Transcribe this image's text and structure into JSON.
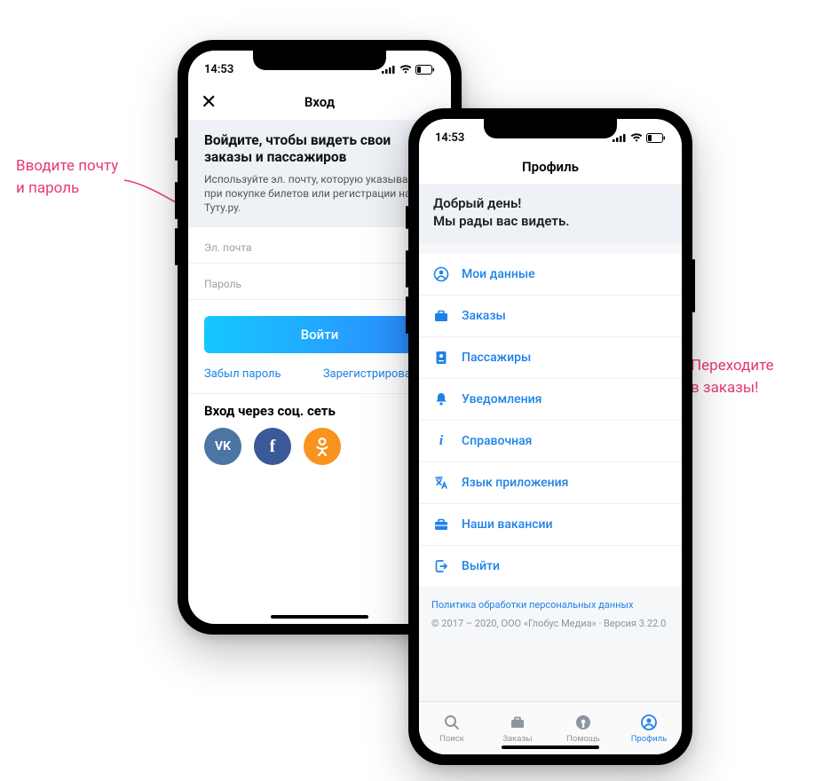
{
  "annotations": {
    "left_line1": "Вводите почту",
    "left_line2": "и пароль",
    "right_line1": "Переходите",
    "right_line2": "в заказы!"
  },
  "status": {
    "time": "14:53"
  },
  "screen1": {
    "nav_title": "Вход",
    "header_title": "Войдите, чтобы видеть свои заказы и пассажиров",
    "header_desc": "Используйте эл. почту, которую указывали при покупке билетов или регистрации на Туту.ру.",
    "email_label": "Эл. почта",
    "password_label": "Пароль",
    "login_btn": "Войти",
    "forgot": "Забыл пароль",
    "register": "Зарегистрироваться",
    "social_title": "Вход через соц. сеть",
    "vk_label": "VK",
    "fb_label": "f"
  },
  "screen2": {
    "nav_title": "Профиль",
    "greeting_line1": "Добрый день!",
    "greeting_line2": "Мы рады вас видеть.",
    "menu": {
      "my_data": "Мои данные",
      "orders": "Заказы",
      "passengers": "Пассажиры",
      "notifications": "Уведомления",
      "help": "Справочная",
      "language": "Язык приложения",
      "vacancies": "Наши вакансии",
      "logout": "Выйти"
    },
    "privacy": "Политика обработки персональных данных",
    "copyright": "© 2017 – 2020, ООО «Глобус Медиа» · Версия 3.22.0",
    "tabs": {
      "search": "Поиск",
      "orders": "Заказы",
      "help": "Помощь",
      "profile": "Профиль"
    }
  }
}
